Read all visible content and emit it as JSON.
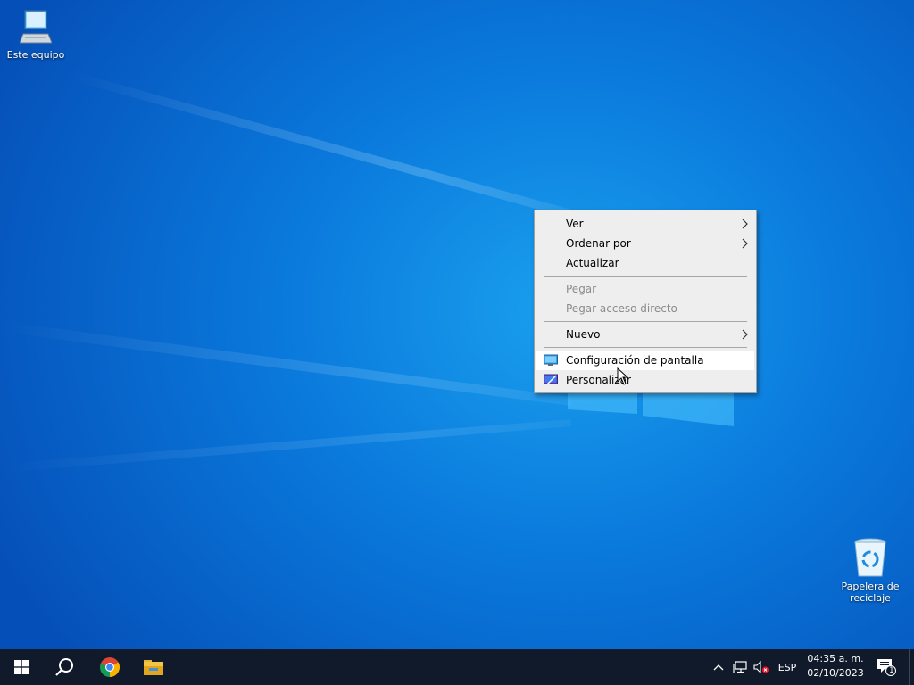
{
  "desktop": {
    "icons": [
      {
        "label": "Este equipo",
        "icon": "computer-icon"
      },
      {
        "label_line1": "Papelera de",
        "label_line2": "reciclaje",
        "icon": "recycle-bin-icon"
      }
    ]
  },
  "context_menu": {
    "items": [
      {
        "label": "Ver",
        "submenu": true,
        "enabled": true
      },
      {
        "label": "Ordenar por",
        "submenu": true,
        "enabled": true
      },
      {
        "label": "Actualizar",
        "submenu": false,
        "enabled": true
      },
      {
        "label": "Pegar",
        "submenu": false,
        "enabled": false
      },
      {
        "label": "Pegar acceso directo",
        "submenu": false,
        "enabled": false
      },
      {
        "label": "Nuevo",
        "submenu": true,
        "enabled": true
      },
      {
        "label": "Configuración de pantalla",
        "submenu": false,
        "enabled": true,
        "icon": "display-settings-icon",
        "hovered": true
      },
      {
        "label": "Personalizar",
        "submenu": false,
        "enabled": true,
        "icon": "personalize-icon"
      }
    ]
  },
  "taskbar": {
    "pinned": [
      "start-icon",
      "search-icon",
      "chrome-icon",
      "file-explorer-icon"
    ],
    "tray": {
      "language": "ESP",
      "time": "04:35 a. m.",
      "date": "02/10/2023",
      "notification_count": "1"
    }
  },
  "colors": {
    "taskbar": "#101a2a",
    "menu_bg": "#eeeeee",
    "menu_hover": "#ffffff",
    "disabled_text": "#8c8c8c"
  }
}
